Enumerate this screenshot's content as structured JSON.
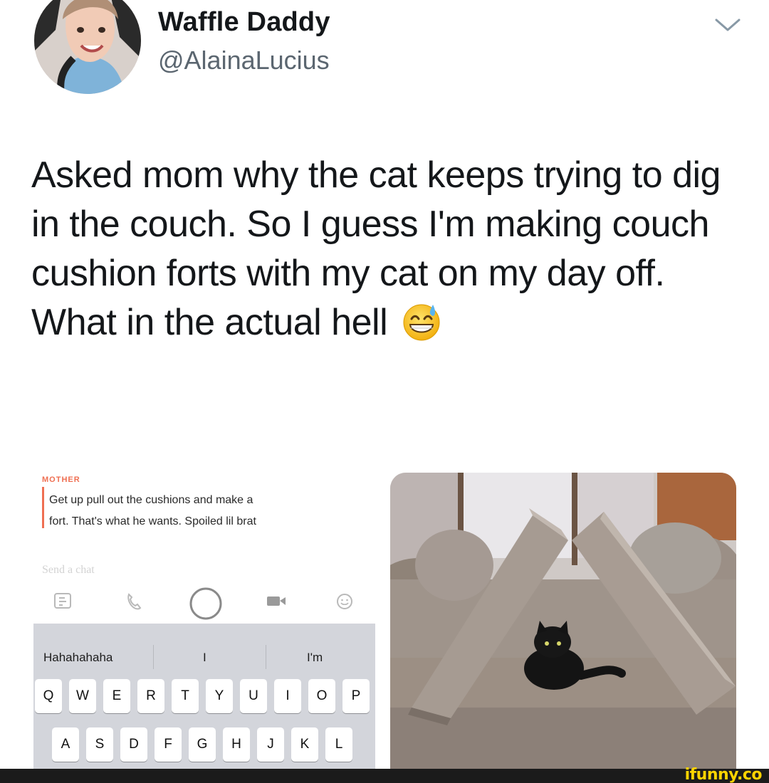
{
  "tweet": {
    "display_name": "Waffle Daddy",
    "handle": "@AlainaLucius",
    "text": "Asked mom why the cat keeps trying to dig in the couch. So I guess I'm making couch cushion forts with my cat on my day off. What in the actual hell",
    "emoji": "grinning-face-with-sweat-icon",
    "menu_icon": "chevron-down-icon"
  },
  "chat": {
    "sender": "MOTHER",
    "message_line1": "Get up pull out the cushions and make a",
    "message_line2": "fort. That's what he wants.  Spoiled lil brat",
    "input_placeholder": "Send a chat",
    "toolbar_icons": [
      "sticker-icon",
      "phone-icon",
      "capture-button",
      "video-icon",
      "emoji-icon"
    ],
    "suggestions": [
      "Hahahahaha",
      "I",
      "I'm"
    ],
    "keyboard_row1": [
      "Q",
      "W",
      "E",
      "R",
      "T",
      "Y",
      "U",
      "I",
      "O",
      "P"
    ],
    "keyboard_row2": [
      "A",
      "S",
      "D",
      "F",
      "G",
      "H",
      "J",
      "K",
      "L"
    ]
  },
  "colors": {
    "snap_accent": "#ef6f52",
    "keyboard_bg": "#d3d5db",
    "brand_yellow": "#ffd400"
  },
  "watermark": "ifunny.co"
}
